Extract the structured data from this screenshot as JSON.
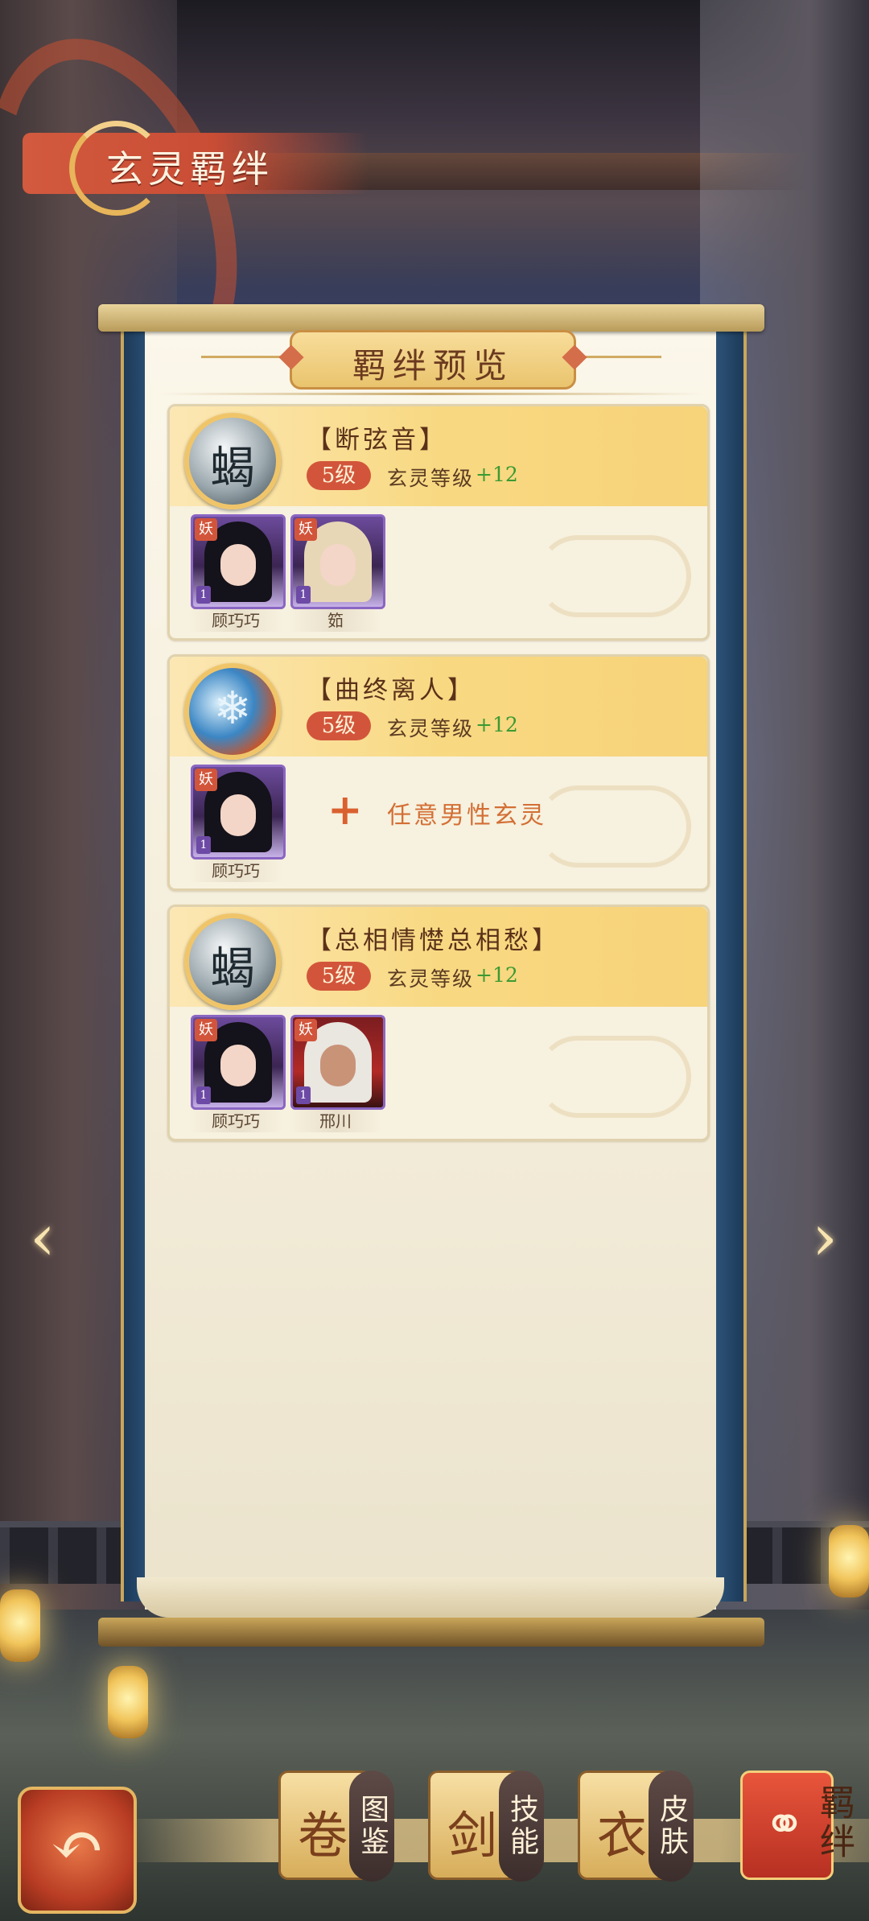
{
  "header": {
    "title": "玄灵羁绊"
  },
  "panel": {
    "title": "羁绊预览"
  },
  "bonds": [
    {
      "name": "【断弦音】",
      "level": "5级",
      "bonus_label": "玄灵等级",
      "bonus_value": "+12",
      "medal_icon": "scorpion-icon",
      "members": [
        {
          "name": "顾巧巧",
          "tag": "妖",
          "level": "1"
        },
        {
          "name": "筎",
          "tag": "妖",
          "level": "1"
        }
      ]
    },
    {
      "name": "【曲终离人】",
      "level": "5级",
      "bonus_label": "玄灵等级",
      "bonus_value": "+12",
      "medal_icon": "fire-ice-icon",
      "members": [
        {
          "name": "顾巧巧",
          "tag": "妖",
          "level": "1"
        }
      ],
      "extra_slot": {
        "plus": "+",
        "label": "任意男性玄灵"
      }
    },
    {
      "name": "【总相情憷总相愁】",
      "level": "5级",
      "bonus_label": "玄灵等级",
      "bonus_value": "+12",
      "medal_icon": "scorpion-icon",
      "members": [
        {
          "name": "顾巧巧",
          "tag": "妖",
          "level": "1"
        },
        {
          "name": "邢川",
          "tag": "妖",
          "level": "1"
        }
      ]
    }
  ],
  "nav": {
    "prev_icon": "‹",
    "next_icon": "›"
  },
  "dock": {
    "back_icon": "↶",
    "tabs": [
      {
        "label": "图鉴",
        "icon": "book-icon",
        "glyph": "卷",
        "active": false
      },
      {
        "label": "技能",
        "icon": "sword-icon",
        "glyph": "剑",
        "active": false
      },
      {
        "label": "皮肤",
        "icon": "robe-icon",
        "glyph": "衣",
        "active": false
      },
      {
        "label": "羁绊",
        "icon": "bond-icon",
        "glyph": "⚭",
        "active": true
      }
    ]
  },
  "colors": {
    "accent": "#d2553b",
    "bonus_green": "#3b9a33",
    "paper": "#f7f1df"
  }
}
